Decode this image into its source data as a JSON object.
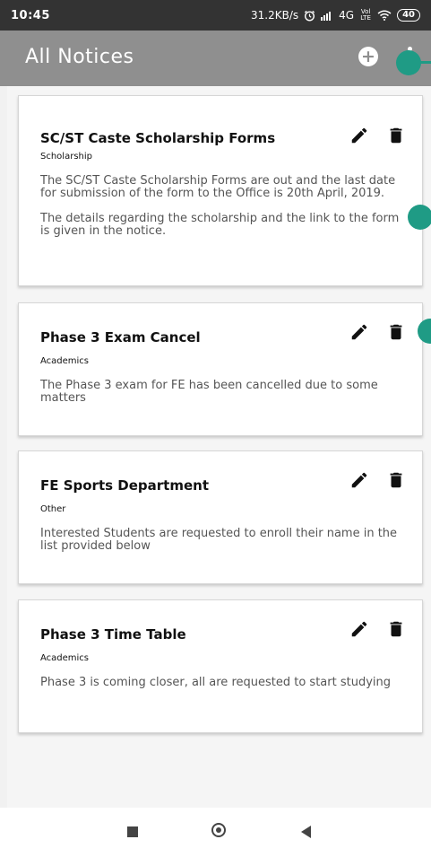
{
  "status_bar": {
    "time": "10:45",
    "network_speed": "31.2KB/s",
    "network_type": "4G",
    "volte": "Vol LTE",
    "battery": "40",
    "alarm_icon": "alarm-icon",
    "signal_icon": "signal-icon",
    "wifi_icon": "wifi-icon"
  },
  "app_bar": {
    "title": "All Notices",
    "add_icon": "plus-circle-icon",
    "more_icon": "more-icon"
  },
  "notices": [
    {
      "title": "SC/ST Caste Scholarship Forms",
      "category": "Scholarship",
      "description": "The SC/ST Caste Scholarship Forms are out and the last date for submission of the form to the Office is 20th April, 2019.\n\nThe details regarding the scholarship and the link to the form is given in the notice.",
      "edit_icon": "pencil-icon",
      "delete_icon": "trash-icon"
    },
    {
      "title": "Phase 3 Exam Cancel",
      "category": "Academics",
      "description": "The Phase 3 exam for FE has been cancelled due to some matters",
      "edit_icon": "pencil-icon",
      "delete_icon": "trash-icon"
    },
    {
      "title": "FE Sports Department",
      "category": "Other",
      "description": "Interested Students are requested to enroll their name in the list provided below",
      "edit_icon": "pencil-icon",
      "delete_icon": "trash-icon"
    },
    {
      "title": "Phase 3 Time Table",
      "category": "Academics",
      "description": "Phase 3 is coming closer, all are requested to start studying",
      "edit_icon": "pencil-icon",
      "delete_icon": "trash-icon"
    }
  ],
  "nav_bar": {
    "recents_icon": "square-icon",
    "home_icon": "circle-icon",
    "back_icon": "back-triangle-icon"
  },
  "colors": {
    "app_bar": "#8f8f8f",
    "status_bar": "#333333",
    "accent_teal": "#1f9b85"
  }
}
